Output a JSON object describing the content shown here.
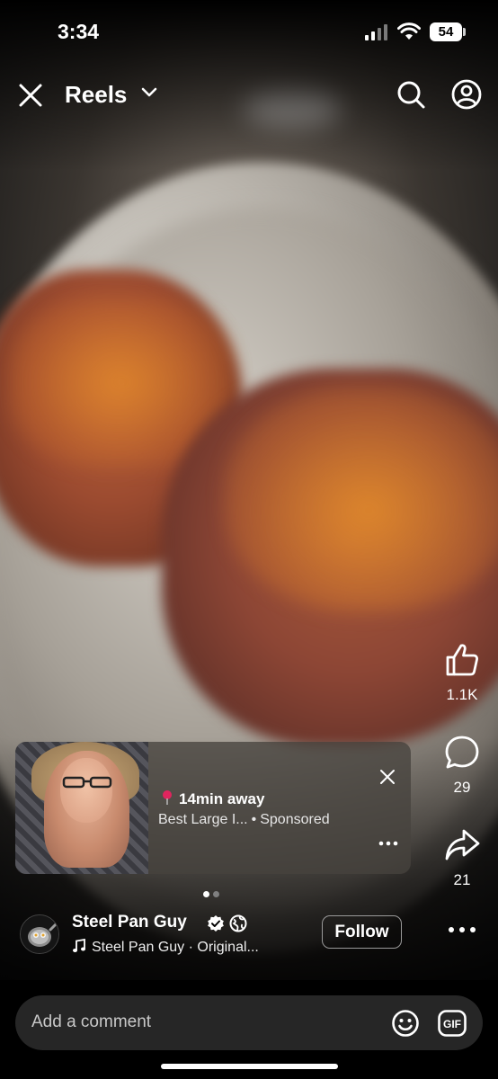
{
  "status_bar": {
    "time": "3:34",
    "battery": "54"
  },
  "header": {
    "title": "Reels"
  },
  "actions": {
    "like_count": "1.1K",
    "comment_count": "29",
    "share_count": "21"
  },
  "ad": {
    "location": "14min away",
    "title": "Best Large I...",
    "label": "Sponsored",
    "separator": "•"
  },
  "pager": {
    "total": 2,
    "active": 1
  },
  "creator": {
    "name": "Steel Pan Guy",
    "audio": "Steel Pan Guy · Original...",
    "follow_label": "Follow"
  },
  "comment_bar": {
    "placeholder": "Add a comment",
    "gif_label": "GIF"
  },
  "colors": {
    "background": "#000000",
    "comment_bar": "#262626",
    "pin": "#e0245e",
    "verified": "#ffffff"
  },
  "icons": [
    "close-icon",
    "chevron-down-icon",
    "search-icon",
    "profile-icon",
    "like-icon",
    "comment-icon",
    "share-icon",
    "more-icon",
    "location-pin-icon",
    "verified-icon",
    "globe-icon",
    "music-note-icon",
    "emoji-icon",
    "gif-icon"
  ]
}
